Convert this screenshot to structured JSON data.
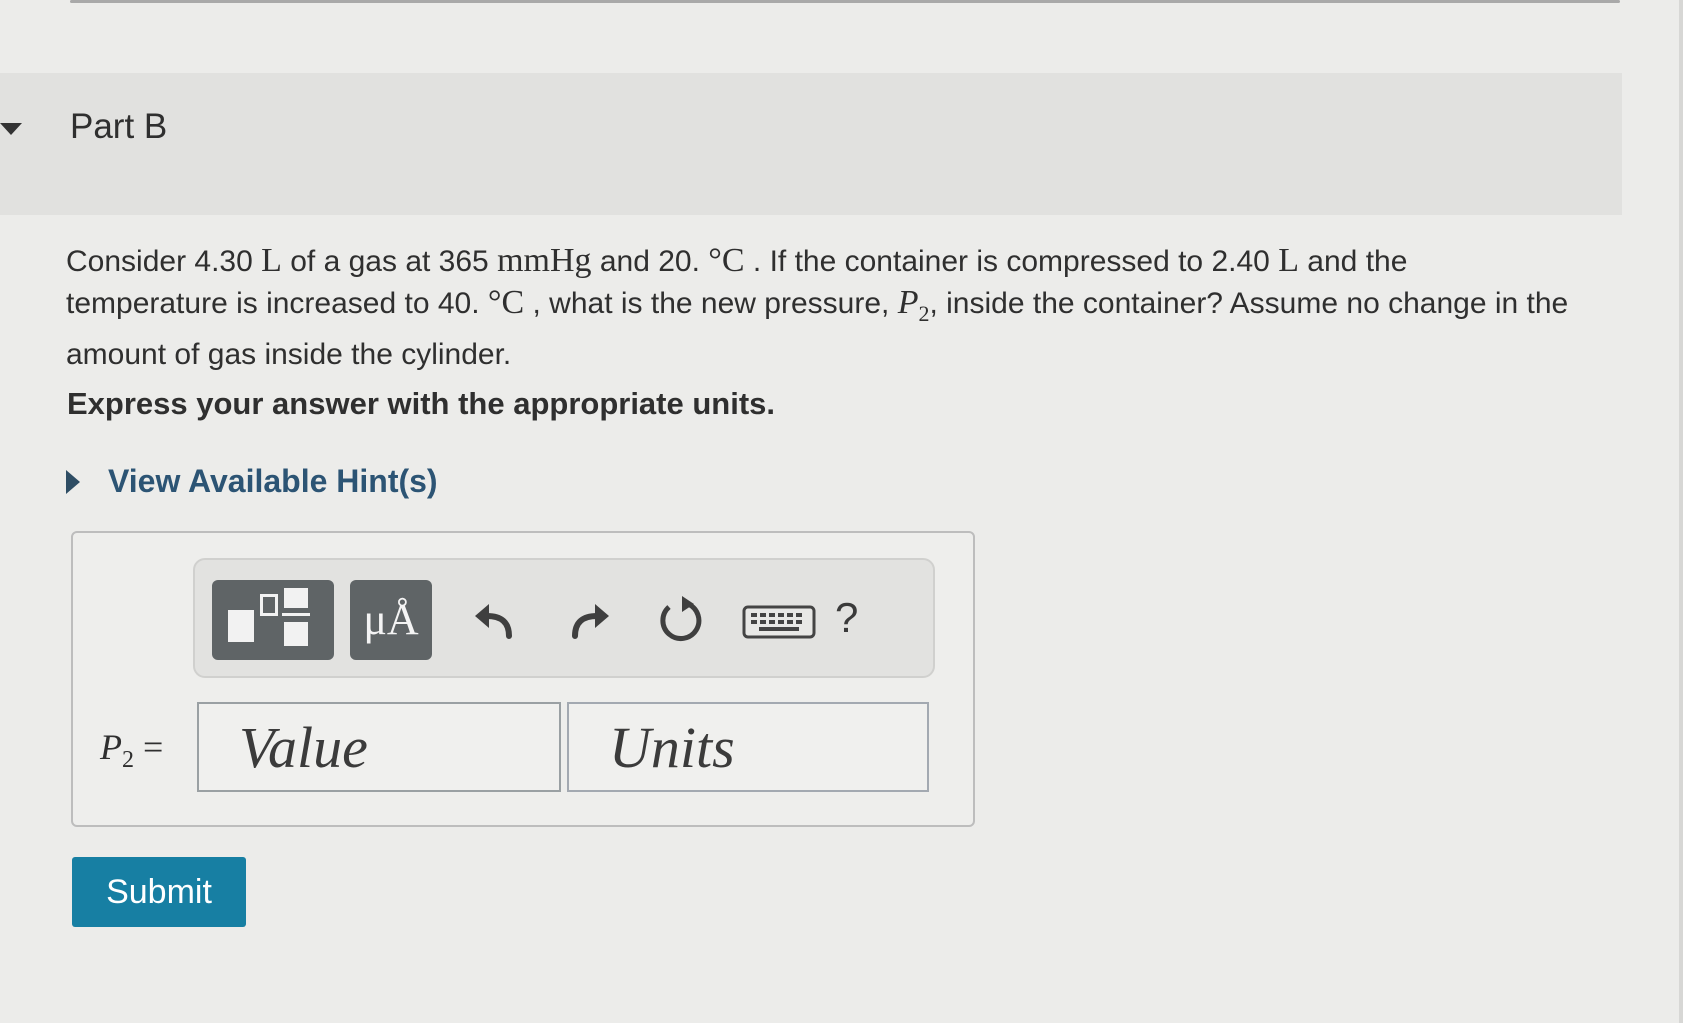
{
  "part": {
    "title": "Part B"
  },
  "question": {
    "t1": "Consider 4.30 ",
    "u1": "L",
    "t2": " of a gas at 365 ",
    "u2": "mmHg",
    "t3": " and 20. ",
    "u3": "°C",
    "t4": " . If the container is compressed to 2.40 ",
    "u4": "L",
    "t5": " and the temperature is increased to 40. ",
    "u5": "°C",
    "t6": " , what is the new pressure, ",
    "var": "P",
    "var_sub": "2",
    "t7": ", inside the container? Assume no change in the amount of gas inside the cylinder."
  },
  "instruction": "Express your answer with the appropriate units.",
  "hints": {
    "label": "View Available Hint(s)"
  },
  "toolbar": {
    "units_glyph": "μÅ",
    "help_label": "?",
    "icons": [
      "templates-icon",
      "units-icon",
      "undo-icon",
      "redo-icon",
      "reset-icon",
      "keyboard-icon",
      "help-icon"
    ]
  },
  "answer": {
    "label_var": "P",
    "label_sub": "2",
    "label_eq": " =",
    "value_placeholder": "Value",
    "units_placeholder": "Units"
  },
  "submit": {
    "label": "Submit",
    "color": "#177fa3"
  }
}
